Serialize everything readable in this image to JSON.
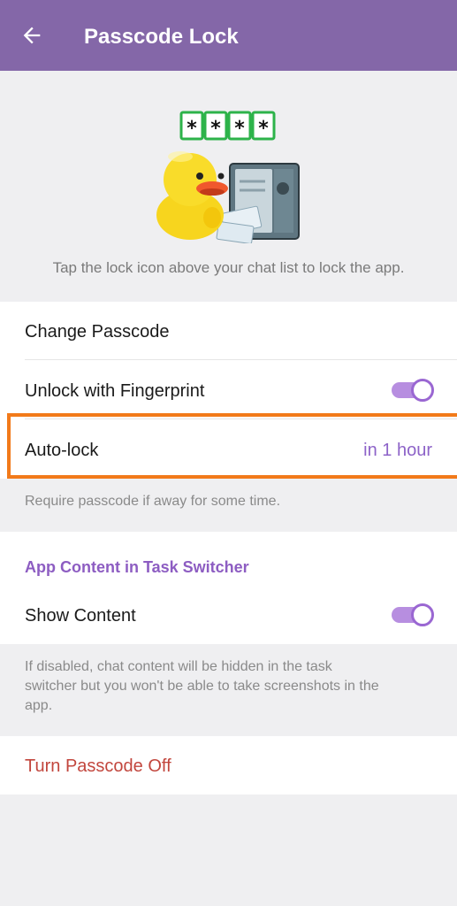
{
  "appbar": {
    "title": "Passcode Lock",
    "back_icon": "arrow-left-icon"
  },
  "hero": {
    "passcode_placeholder": [
      "*",
      "*",
      "*",
      "*"
    ],
    "sticker": "duck-with-safe-sticker",
    "hint": "Tap the lock icon above your chat list to lock the app."
  },
  "settings": {
    "change_passcode": "Change Passcode",
    "unlock_fingerprint": "Unlock with Fingerprint",
    "unlock_fingerprint_on": true,
    "auto_lock_label": "Auto-lock",
    "auto_lock_value": "in 1 hour",
    "auto_lock_note": "Require passcode if away for some time."
  },
  "task_switcher": {
    "header": "App Content in Task Switcher",
    "show_content": "Show Content",
    "show_content_on": true,
    "note_line1": "If disabled, chat content will be hidden in the task",
    "note_line2": "switcher but you won't be able to take screenshots in the",
    "note_line3": "app."
  },
  "danger": {
    "turn_off": "Turn Passcode Off"
  },
  "colors": {
    "appbar": "#8467a8",
    "accent": "#8d63c8",
    "danger": "#c2463d",
    "highlight": "#f27a1a"
  }
}
